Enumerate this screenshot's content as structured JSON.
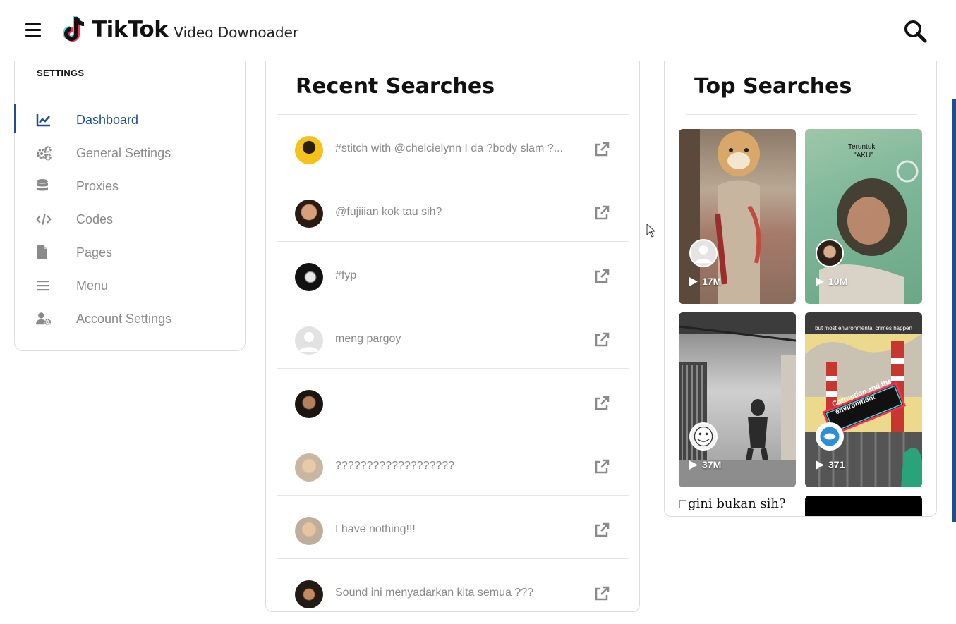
{
  "header": {
    "brand": "TikTok",
    "subtitle": "Video Downoader",
    "menu_icon": "hamburger-icon",
    "search_icon": "search-icon"
  },
  "settings": {
    "title": "SETTINGS",
    "items": [
      {
        "label": "Dashboard",
        "icon": "chart-line-icon",
        "active": true
      },
      {
        "label": "General Settings",
        "icon": "gears-icon",
        "active": false
      },
      {
        "label": "Proxies",
        "icon": "database-icon",
        "active": false
      },
      {
        "label": "Codes",
        "icon": "code-icon",
        "active": false
      },
      {
        "label": "Pages",
        "icon": "file-icon",
        "active": false
      },
      {
        "label": "Menu",
        "icon": "bars-icon",
        "active": false
      },
      {
        "label": "Account Settings",
        "icon": "user-cog-icon",
        "active": false
      }
    ]
  },
  "recent": {
    "title": "Recent Searches",
    "rows": [
      {
        "text": "#stitch with @chelcielynn I da ?body slam ?..."
      },
      {
        "text": "@fujiiian kok tau sih?"
      },
      {
        "text": "#fyp"
      },
      {
        "text": "meng pargoy"
      },
      {
        "text": ""
      },
      {
        "text": "???????????????????"
      },
      {
        "text": "I have nothing!!!"
      },
      {
        "text": "Sound ini menyadarkan kita semua ???"
      }
    ]
  },
  "top": {
    "title": "Top Searches",
    "tiles": [
      {
        "plays": "17M"
      },
      {
        "plays": "10M"
      },
      {
        "plays": "37M",
        "caption": ""
      },
      {
        "plays": "371",
        "overlay_text": "but most environmental crimes happen",
        "sticker": "Corruption and the environment"
      }
    ],
    "broken_image_alt": "gini bukan sih?",
    "tile2_caption": "Teruntuk : \"AKU\""
  },
  "colors": {
    "accent": "#1f4e8c",
    "muted_text": "#8a8a8a"
  }
}
